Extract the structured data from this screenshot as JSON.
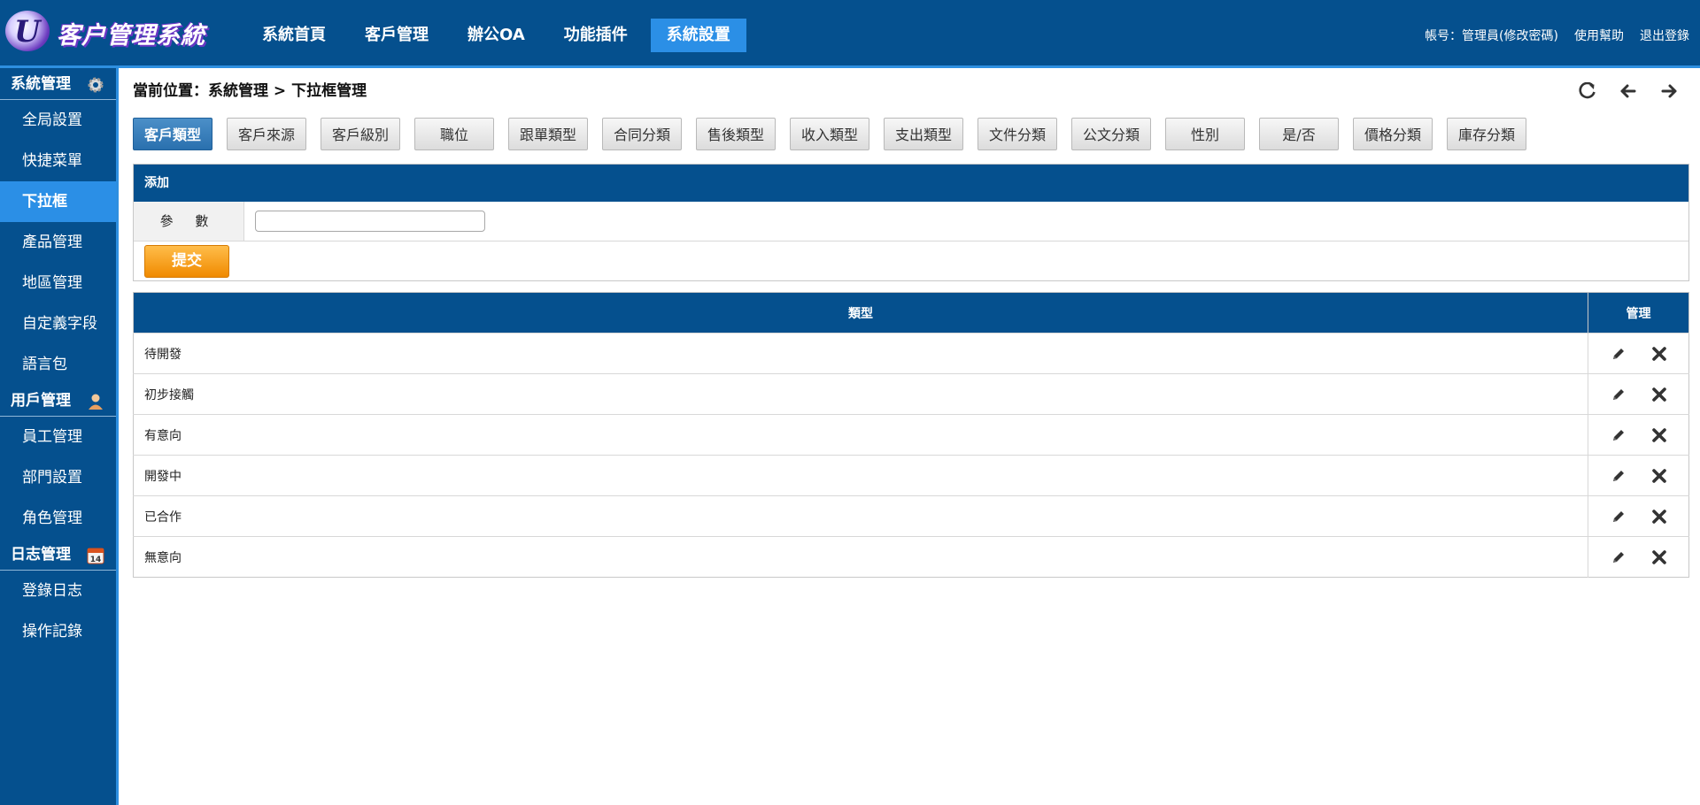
{
  "header": {
    "logo_text": "客户管理系統",
    "nav": [
      "系統首頁",
      "客戶管理",
      "辦公OA",
      "功能插件",
      "系統設置"
    ],
    "active_nav": "系統設置",
    "account": "帳号：管理員(修改密碼)",
    "help": "使用幫助",
    "logout": "退出登錄"
  },
  "sidebar": {
    "sections": [
      {
        "title": "系統管理",
        "icon": "gear-icon",
        "items": [
          "全局設置",
          "快捷菜單",
          "下拉框",
          "產品管理",
          "地區管理",
          "自定義字段",
          "語言包"
        ]
      },
      {
        "title": "用戶管理",
        "icon": "user-icon",
        "items": [
          "員工管理",
          "部門設置",
          "角色管理"
        ]
      },
      {
        "title": "日志管理",
        "icon": "calendar-icon",
        "icon_text": "14",
        "items": [
          "登錄日志",
          "操作記錄"
        ]
      }
    ],
    "active_item": "下拉框"
  },
  "breadcrumb": "當前位置：系統管理 > 下拉框管理",
  "tools": [
    "refresh-icon",
    "back-icon",
    "forward-icon"
  ],
  "tabs": [
    "客戶類型",
    "客戶來源",
    "客戶級別",
    "職位",
    "跟單類型",
    "合同分類",
    "售後類型",
    "收入類型",
    "支出類型",
    "文件分類",
    "公文分類",
    "性別",
    "是/否",
    "價格分類",
    "庫存分類"
  ],
  "active_tab": "客戶類型",
  "add_form": {
    "title": "添加",
    "param_label": "參 數",
    "param_value": "",
    "submit_label": "提交"
  },
  "table": {
    "col_type": "類型",
    "col_manage": "管理",
    "rows": [
      "待開發",
      "初步接觸",
      "有意向",
      "開發中",
      "已合作",
      "無意向"
    ]
  },
  "colors": {
    "brand_blue": "#05508e",
    "active_blue": "#2b8fe6",
    "submit_orange": "#f39c12"
  }
}
